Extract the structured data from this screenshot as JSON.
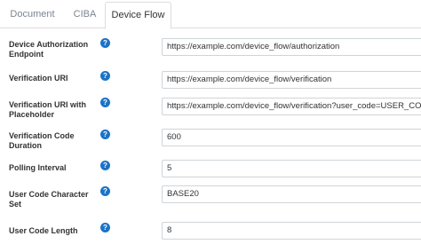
{
  "tabs": [
    {
      "label": "Document"
    },
    {
      "label": "CIBA"
    },
    {
      "label": "Device Flow"
    }
  ],
  "help_glyph": "?",
  "fields": [
    {
      "label": "Device Authorization Endpoint",
      "value": "https://example.com/device_flow/authorization"
    },
    {
      "label": "Verification URI",
      "value": "https://example.com/device_flow/verification"
    },
    {
      "label": "Verification URI with Placeholder",
      "value": "https://example.com/device_flow/verification?user_code=USER_CODE"
    },
    {
      "label": "Verification Code Duration",
      "value": "600"
    },
    {
      "label": "Polling Interval",
      "value": "5"
    },
    {
      "label": "User Code Character Set",
      "value": "BASE20"
    },
    {
      "label": "User Code Length",
      "value": "8"
    }
  ],
  "colors": {
    "accent": "#1a73c8",
    "border": "#dddddd",
    "tab_inactive": "#7a8590"
  }
}
